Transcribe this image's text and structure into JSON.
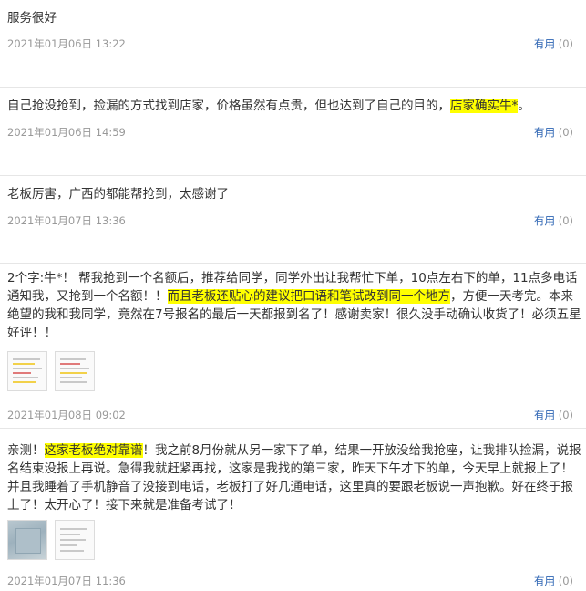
{
  "helpful_label": "有用",
  "reviews": [
    {
      "segments": [
        {
          "text": "服务很好",
          "highlight": false
        }
      ],
      "date": "2021年01月06日 13:22",
      "helpful_count": "(0)"
    },
    {
      "segments": [
        {
          "text": "自己抢没抢到，捡漏的方式找到店家，价格虽然有点贵，但也达到了自己的目的，",
          "highlight": false
        },
        {
          "text": "店家确实牛*",
          "highlight": true
        },
        {
          "text": "。",
          "highlight": false
        }
      ],
      "date": "2021年01月06日 14:59",
      "helpful_count": "(0)"
    },
    {
      "segments": [
        {
          "text": "老板厉害，广西的都能帮抢到，太感谢了",
          "highlight": false
        }
      ],
      "date": "2021年01月07日 13:36",
      "helpful_count": "(0)"
    },
    {
      "segments": [
        {
          "text": "2个字:牛*！ 帮我抢到一个名额后，推荐给同学，同学外出让我帮忙下单，10点左右下的单，11点多电话通知我，又抢到一个名额！！",
          "highlight": false
        },
        {
          "text": "而且老板还贴心的建议把口语和笔试改到同一个地方",
          "highlight": true
        },
        {
          "text": "，方便一天考完。本来绝望的我和我同学，竟然在7号报名的最后一天都报到名了！感谢卖家！很久没手动确认收货了！必须五星好评！！",
          "highlight": false
        }
      ],
      "images": [
        "document-thumbnail",
        "document-thumbnail"
      ],
      "date": "2021年01月08日 09:02",
      "helpful_count": "(0)"
    },
    {
      "segments": [
        {
          "text": "亲测！",
          "highlight": false
        },
        {
          "text": "这家老板绝对靠谱",
          "highlight": true
        },
        {
          "text": "！我之前8月份就从另一家下了单，结果一开放没给我抢座，让我排队捡漏，说报名结束没报上再说。急得我就赶紧再找，这家是我找的第三家，昨天下午才下的单，今天早上就报上了！并且我睡着了手机静音了没接到电话，老板打了好几通电话，这里真的要跟老板说一声抱歉。好在终于报上了！太开心了！接下来就是准备考试了！",
          "highlight": false
        }
      ],
      "images": [
        "photo-thumbnail",
        "document-thumbnail"
      ],
      "date": "2021年01月07日 11:36",
      "helpful_count": "(0)"
    }
  ]
}
